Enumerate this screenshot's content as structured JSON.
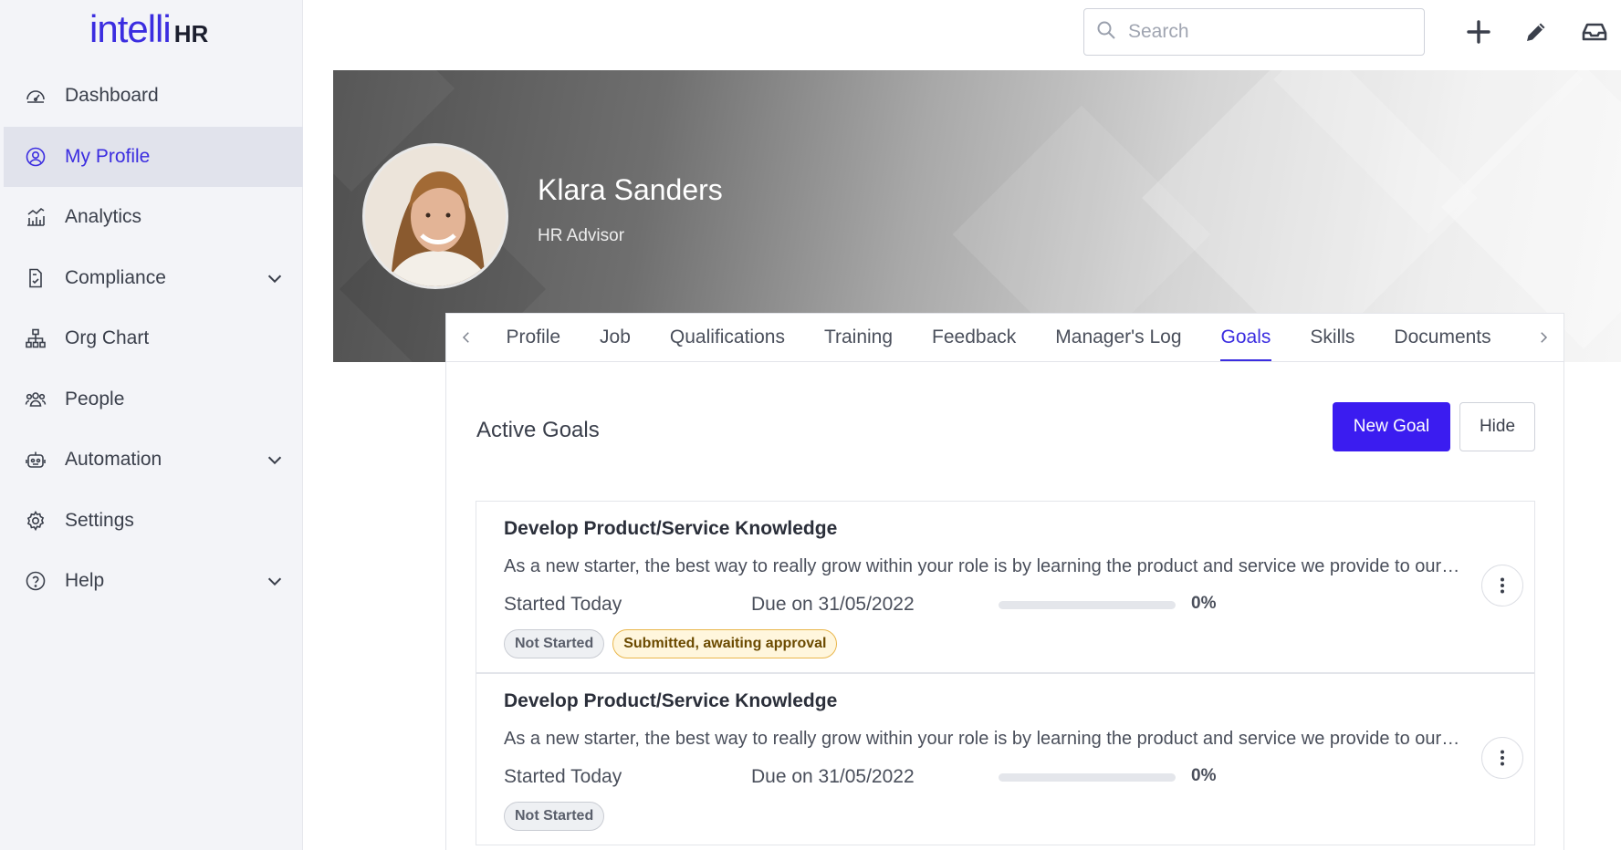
{
  "app": {
    "logo_main": "intelli",
    "logo_suffix": "HR"
  },
  "sidebar": {
    "items": [
      {
        "label": "Dashboard",
        "icon": "dashboard-icon",
        "active": false,
        "expandable": false
      },
      {
        "label": "My Profile",
        "icon": "user-circle-icon",
        "active": true,
        "expandable": false
      },
      {
        "label": "Analytics",
        "icon": "analytics-icon",
        "active": false,
        "expandable": false
      },
      {
        "label": "Compliance",
        "icon": "document-icon",
        "active": false,
        "expandable": true
      },
      {
        "label": "Org Chart",
        "icon": "org-chart-icon",
        "active": false,
        "expandable": false
      },
      {
        "label": "People",
        "icon": "people-icon",
        "active": false,
        "expandable": false
      },
      {
        "label": "Automation",
        "icon": "robot-icon",
        "active": false,
        "expandable": true
      },
      {
        "label": "Settings",
        "icon": "gear-icon",
        "active": false,
        "expandable": false
      },
      {
        "label": "Help",
        "icon": "help-icon",
        "active": false,
        "expandable": true
      }
    ]
  },
  "topbar": {
    "search_placeholder": "Search",
    "icons": [
      "plus-icon",
      "pencil-icon",
      "inbox-icon"
    ]
  },
  "profile": {
    "name": "Klara Sanders",
    "role": "HR Advisor"
  },
  "tabs": [
    "Profile",
    "Job",
    "Qualifications",
    "Training",
    "Feedback",
    "Manager's Log",
    "Goals",
    "Skills",
    "Documents"
  ],
  "active_tab": "Goals",
  "goals_section": {
    "title": "Active Goals",
    "new_goal_label": "New Goal",
    "hide_label": "Hide",
    "goals": [
      {
        "title": "Develop Product/Service Knowledge",
        "description": "As a new starter, the best way to really grow within your role is by learning the product and service we provide to our customers.",
        "started": "Started Today",
        "due": "Due on 31/05/2022",
        "progress_pct": 0,
        "progress_label": "0%",
        "badges": [
          {
            "label": "Not Started",
            "style": "gray"
          },
          {
            "label": "Submitted, awaiting approval",
            "style": "yellow"
          }
        ]
      },
      {
        "title": "Develop Product/Service Knowledge",
        "description": "As a new starter, the best way to really grow within your role is by learning the product and service we provide to our customers.",
        "started": "Started Today",
        "due": "Due on 31/05/2022",
        "progress_pct": 0,
        "progress_label": "0%",
        "badges": [
          {
            "label": "Not Started",
            "style": "gray"
          }
        ]
      }
    ]
  },
  "colors": {
    "accent": "#3b1cf0",
    "sidebar_bg": "#f3f4f8",
    "active_nav_bg": "#e1e3ec"
  }
}
